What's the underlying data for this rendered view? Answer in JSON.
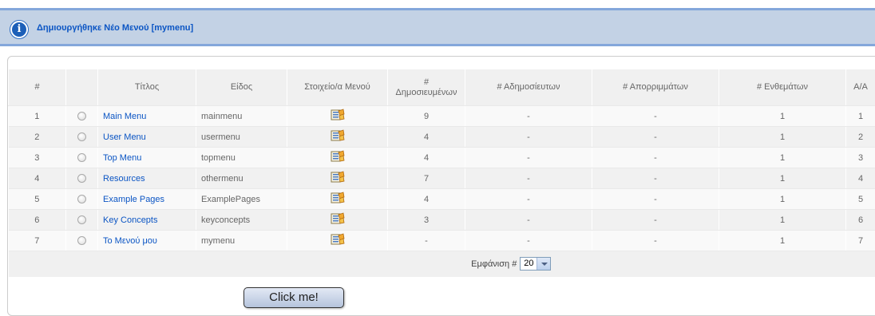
{
  "message": {
    "text": "Δημιουργήθηκε Νέο Μενού [mymenu]",
    "icon": "info-icon"
  },
  "table": {
    "headers": {
      "num": "#",
      "select": "",
      "title": "Τίτλος",
      "type": "Είδος",
      "menu_items": "Στοιχείο/α Μενού",
      "published_hash": "#",
      "published": "Δημοσιευμένων",
      "unpublished": "# Αδημοσίευτων",
      "trashed": "# Απορριμμάτων",
      "modules": "# Ενθεμάτων",
      "id": "A/A"
    },
    "rows": [
      {
        "num": "1",
        "title": "Main Menu",
        "type": "mainmenu",
        "published": "9",
        "unpublished": "-",
        "trashed": "-",
        "modules": "1",
        "id": "1"
      },
      {
        "num": "2",
        "title": "User Menu",
        "type": "usermenu",
        "published": "4",
        "unpublished": "-",
        "trashed": "-",
        "modules": "1",
        "id": "2"
      },
      {
        "num": "3",
        "title": "Top Menu",
        "type": "topmenu",
        "published": "4",
        "unpublished": "-",
        "trashed": "-",
        "modules": "1",
        "id": "3"
      },
      {
        "num": "4",
        "title": "Resources",
        "type": "othermenu",
        "published": "7",
        "unpublished": "-",
        "trashed": "-",
        "modules": "1",
        "id": "4"
      },
      {
        "num": "5",
        "title": "Example Pages",
        "type": "ExamplePages",
        "published": "4",
        "unpublished": "-",
        "trashed": "-",
        "modules": "1",
        "id": "5"
      },
      {
        "num": "6",
        "title": "Key Concepts",
        "type": "keyconcepts",
        "published": "3",
        "unpublished": "-",
        "trashed": "-",
        "modules": "1",
        "id": "6"
      },
      {
        "num": "7",
        "title": "Το Μενού μου",
        "type": "mymenu",
        "published": "-",
        "unpublished": "-",
        "trashed": "-",
        "modules": "1",
        "id": "7"
      }
    ]
  },
  "footer": {
    "display_label": "Εμφάνιση #",
    "limit_value": "20"
  },
  "callout": {
    "text": "Click me!"
  },
  "colors": {
    "link": "#0b55c4",
    "message_bg": "#c3d2e5",
    "message_border": "#84a7db"
  }
}
